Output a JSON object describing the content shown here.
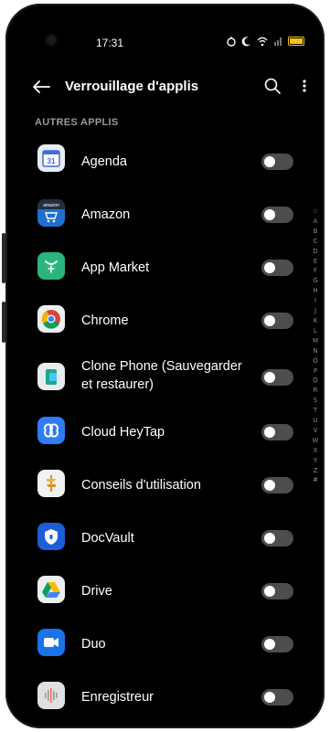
{
  "status_bar": {
    "time": "17:31"
  },
  "header": {
    "title": "Verrouillage d'applis"
  },
  "section_label": "AUTRES APPLIS",
  "apps": [
    {
      "name": "Agenda",
      "icon": "calendar-icon",
      "icon_text": "31"
    },
    {
      "name": "Amazon",
      "icon": "amazon-icon",
      "icon_text": "amazon"
    },
    {
      "name": "App Market",
      "icon": "app-market-icon"
    },
    {
      "name": "Chrome",
      "icon": "chrome-icon"
    },
    {
      "name": "Clone Phone (Sauvegarder\net restaurer)",
      "icon": "clone-phone-icon"
    },
    {
      "name": "Cloud HeyTap",
      "icon": "cloud-heytap-icon"
    },
    {
      "name": "Conseils d'utilisation",
      "icon": "tips-icon"
    },
    {
      "name": "DocVault",
      "icon": "docvault-icon"
    },
    {
      "name": "Drive",
      "icon": "drive-icon"
    },
    {
      "name": "Duo",
      "icon": "duo-icon"
    },
    {
      "name": "Enregistreur",
      "icon": "recorder-icon"
    }
  ],
  "alphabet_index": [
    "☆",
    "A",
    "B",
    "C",
    "D",
    "E",
    "F",
    "G",
    "H",
    "I",
    "J",
    "K",
    "L",
    "M",
    "N",
    "O",
    "P",
    "Q",
    "R",
    "S",
    "T",
    "U",
    "V",
    "W",
    "X",
    "Y",
    "Z",
    "#"
  ]
}
